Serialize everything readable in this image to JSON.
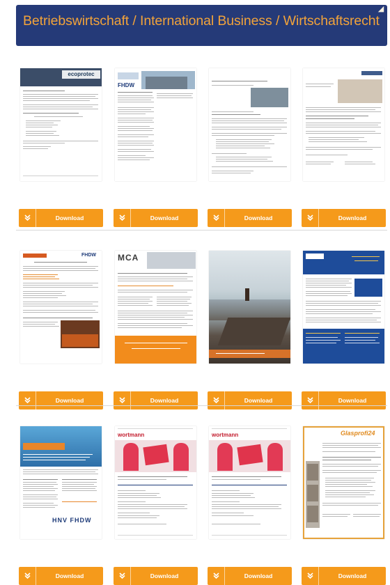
{
  "banner": {
    "title": "Betriebswirtschaft / International Business / Wirtschaftsrecht"
  },
  "download_label": "Download",
  "colors": {
    "banner_bg": "#253a78",
    "banner_text": "#f2a33a",
    "button_bg": "#f59a1b"
  },
  "rows": [
    {
      "cards": [
        {
          "thumb_text": "ecoprotec"
        },
        {
          "thumb_text": "FHDW"
        },
        {
          "thumb_text": ""
        },
        {
          "thumb_text": ""
        }
      ]
    },
    {
      "cards": [
        {
          "thumb_text": "FHDW"
        },
        {
          "thumb_text": "MCA"
        },
        {
          "thumb_text": ""
        },
        {
          "thumb_text": ""
        }
      ]
    },
    {
      "cards": [
        {
          "thumb_text": "HNV FHDW"
        },
        {
          "thumb_text": "wortmann"
        },
        {
          "thumb_text": "wortmann"
        },
        {
          "thumb_text": "Glasprofi24"
        }
      ]
    }
  ]
}
